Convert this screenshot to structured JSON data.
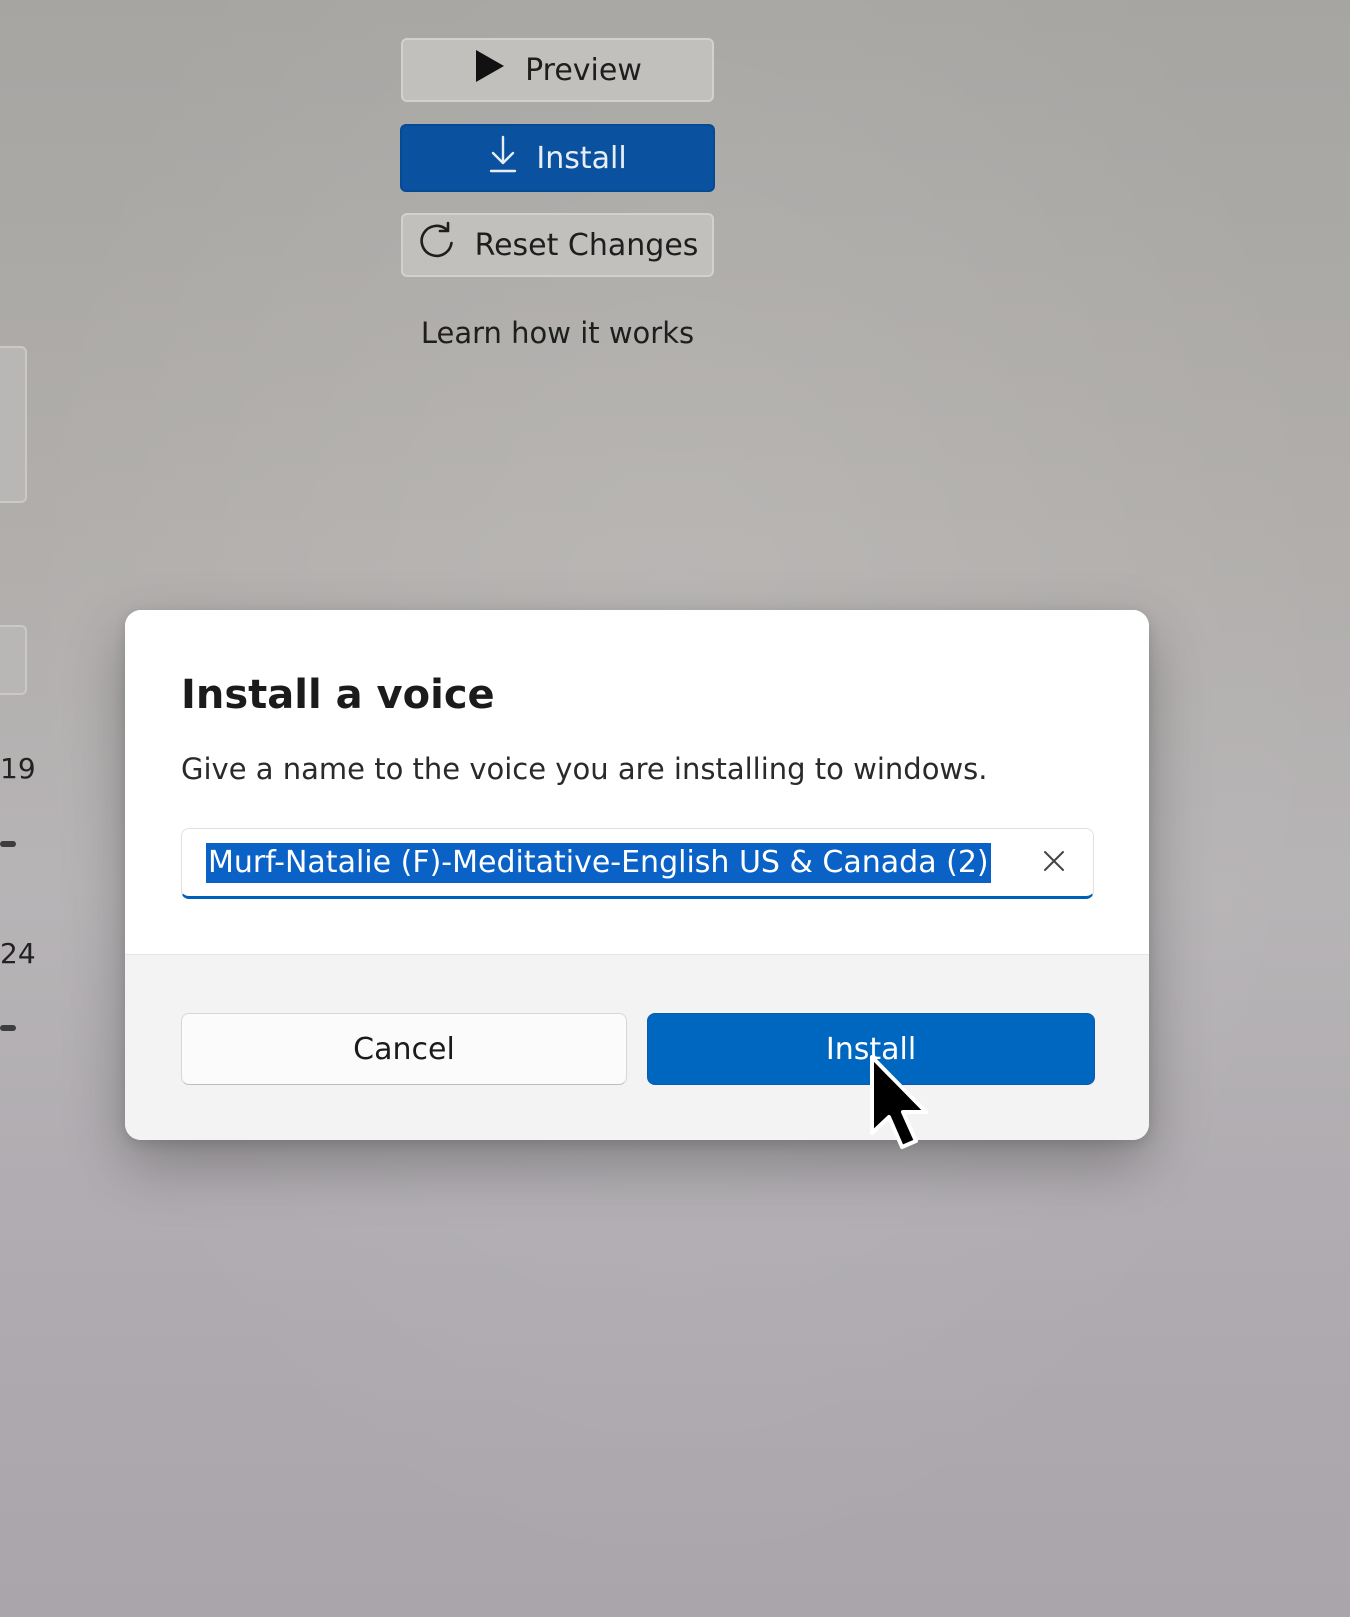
{
  "background": {
    "buttons": {
      "preview_label": "Preview",
      "install_label": "Install",
      "reset_label": "Reset Changes"
    },
    "learn_link": "Learn how it works",
    "left_fragments": {
      "value_1": "19",
      "value_2": "24"
    }
  },
  "dialog": {
    "title": "Install a voice",
    "description": "Give a name to the voice you are installing to windows.",
    "voice_name_input": {
      "value": "Murf-Natalie (F)-Meditative-English US & Canada (2)",
      "selected": true
    },
    "cancel_label": "Cancel",
    "install_label": "Install"
  },
  "colors": {
    "accent": "#0067c0",
    "selection": "#0a62c7",
    "background_primary_button": "#0a52a0"
  },
  "icons": {
    "preview": "play-icon",
    "install": "download-icon",
    "reset": "refresh-icon",
    "clear": "close-icon",
    "pointer": "mouse-cursor"
  }
}
